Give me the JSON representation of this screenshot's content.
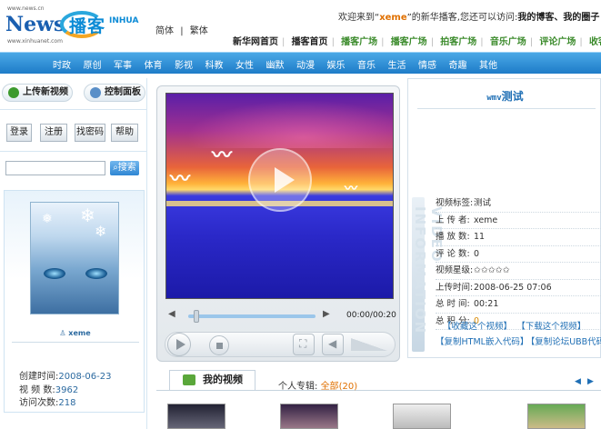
{
  "header": {
    "news_logo": "News",
    "news_logo_url": "www.news.cn",
    "news_logo_url2": "www.xinhuanet.com",
    "logo_zh": "播客",
    "logo_en": "INHUA",
    "lang_simplified": "简体",
    "lang_sep": "|",
    "lang_traditional": "繁体",
    "welcome_prefix": "欢迎来到“",
    "welcome_user": "xeme",
    "welcome_suffix": "”的新华播客,您还可以访问:",
    "welcome_link1": "我的博客、",
    "welcome_link2": "我的圈子"
  },
  "topnav": {
    "items": [
      "新华网首页",
      "播客首页",
      "播客广场",
      "播客广场",
      "拍客广场",
      "音乐广场",
      "评论广场",
      "收客广场"
    ]
  },
  "categories": [
    "时政",
    "原创",
    "军事",
    "体育",
    "影视",
    "科教",
    "女性",
    "幽默",
    "动漫",
    "娱乐",
    "音乐",
    "生活",
    "情感",
    "奇趣",
    "其他"
  ],
  "sidebar": {
    "upload_label": "上传新视频",
    "panel_label": "控制面板",
    "login": "登录",
    "register": "注册",
    "find_password": "找密码",
    "help": "帮助",
    "search_btn": "搜索",
    "profile_name": "xeme",
    "created_label": "创建时间:",
    "created_value": "2008-06-23",
    "videos_label": "视 频 数:",
    "videos_value": "3962",
    "visits_label": "访问次数:",
    "visits_value": "218"
  },
  "player": {
    "timecode": "00:00/00:20",
    "progress": 0.0
  },
  "video_info": {
    "title_en": "wmv",
    "title_zh": "测试",
    "deco_text": "VIDEO INFORMATION",
    "rows": [
      {
        "k": "视频标签:",
        "v": "测试"
      },
      {
        "k": "上 传 者:",
        "v": "xeme"
      },
      {
        "k": "播 放 数:",
        "v": "11"
      },
      {
        "k": "评 论 数:",
        "v": "0"
      },
      {
        "k": "视频星级:",
        "v": "✩✩✩✩✩"
      },
      {
        "k": "上传时间:",
        "v": "2008-06-25 07:06"
      },
      {
        "k": "总 时 间:",
        "v": "00:21"
      },
      {
        "k": "总 积 分:",
        "v": "0"
      }
    ],
    "link_favorite": "【收藏这个视频】",
    "link_download": "【下载这个视频】",
    "link_html": "【复制HTML嵌入代码】",
    "link_ubb": "【复制论坛UBB代码】"
  },
  "my_videos": {
    "tab_label": "我的视频",
    "album_label": "个人专辑:",
    "all_label": "全部",
    "all_count": "(20)",
    "prev": "◀",
    "next": "▶"
  }
}
